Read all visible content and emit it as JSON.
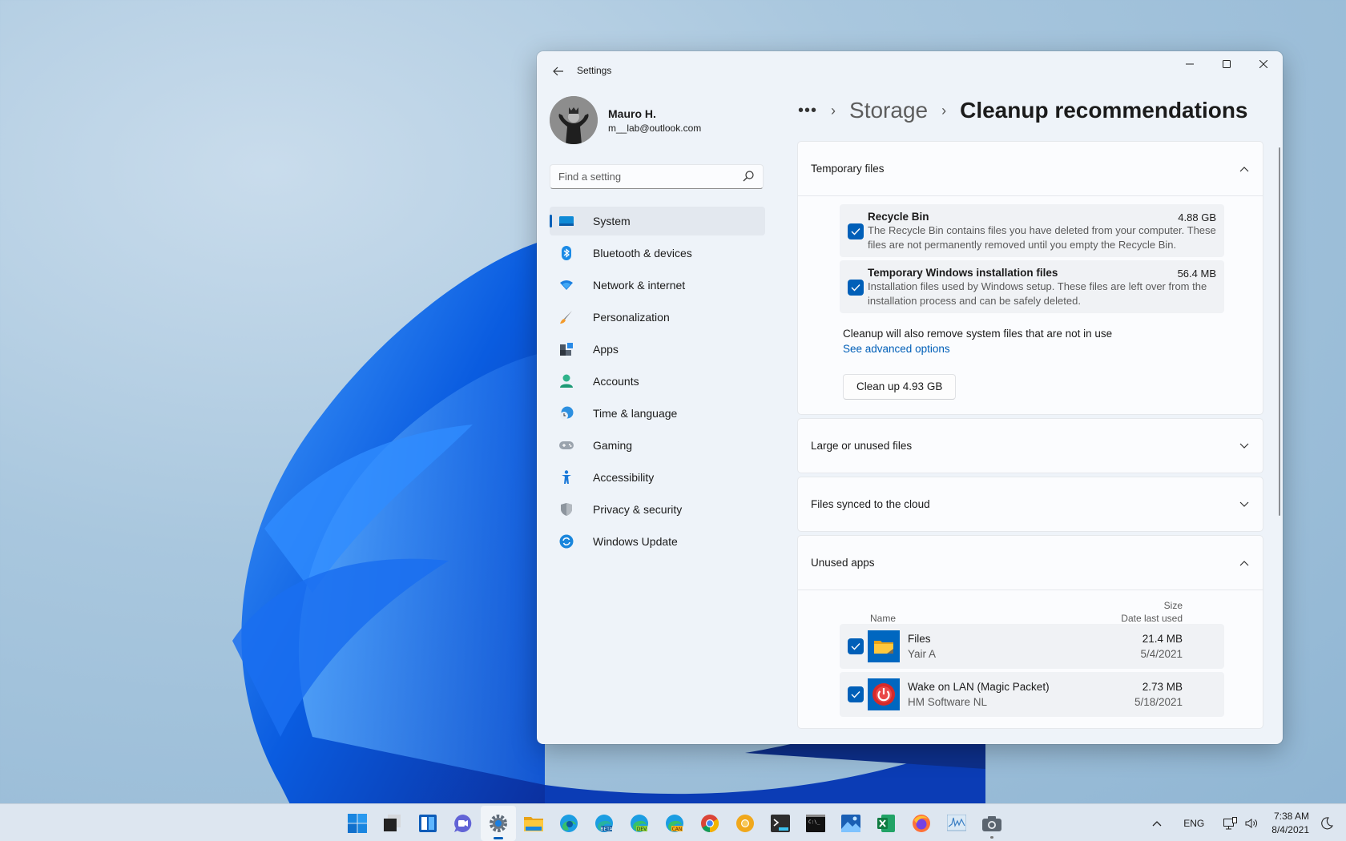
{
  "window": {
    "title": "Settings",
    "controls": {
      "minimize": "minimize",
      "maximize": "maximize",
      "close": "close"
    }
  },
  "profile": {
    "name": "Mauro H.",
    "email": "m__lab@outlook.com"
  },
  "search": {
    "placeholder": "Find a setting",
    "value": ""
  },
  "sidebar": {
    "items": [
      {
        "label": "System",
        "icon": "system-icon",
        "active": true
      },
      {
        "label": "Bluetooth & devices",
        "icon": "bluetooth-icon"
      },
      {
        "label": "Network & internet",
        "icon": "wifi-icon"
      },
      {
        "label": "Personalization",
        "icon": "brush-icon"
      },
      {
        "label": "Apps",
        "icon": "apps-icon"
      },
      {
        "label": "Accounts",
        "icon": "person-icon"
      },
      {
        "label": "Time & language",
        "icon": "globe-clock-icon"
      },
      {
        "label": "Gaming",
        "icon": "gamepad-icon"
      },
      {
        "label": "Accessibility",
        "icon": "accessibility-icon"
      },
      {
        "label": "Privacy & security",
        "icon": "shield-icon"
      },
      {
        "label": "Windows Update",
        "icon": "update-icon"
      }
    ]
  },
  "breadcrumb": {
    "more": "•••",
    "separator": "›",
    "parent": "Storage",
    "current": "Cleanup recommendations"
  },
  "sections": {
    "temporary_files": {
      "title": "Temporary files",
      "expanded": true,
      "items": [
        {
          "title": "Recycle Bin",
          "size": "4.88 GB",
          "checked": true,
          "description": "The Recycle Bin contains files you have deleted from your computer. These files are not permanently removed until you empty the Recycle Bin."
        },
        {
          "title": "Temporary Windows installation files",
          "size": "56.4 MB",
          "checked": true,
          "description": "Installation files used by Windows setup.  These files are left over from the installation process and can be safely deleted."
        }
      ],
      "note": "Cleanup will also remove system files that are not in use",
      "advanced_link": "See advanced options",
      "cleanup_button": "Clean up 4.93 GB"
    },
    "large_files": {
      "title": "Large or unused files",
      "expanded": false
    },
    "cloud_files": {
      "title": "Files synced to the cloud",
      "expanded": false
    },
    "unused_apps": {
      "title": "Unused apps",
      "expanded": true,
      "columns": {
        "name": "Name",
        "size": "Size",
        "date": "Date last used"
      },
      "apps": [
        {
          "name": "Files",
          "publisher": "Yair A",
          "size": "21.4 MB",
          "date": "5/4/2021",
          "checked": true,
          "icon": "folder-icon"
        },
        {
          "name": "Wake on LAN (Magic Packet)",
          "publisher": "HM Software NL",
          "size": "2.73 MB",
          "date": "5/18/2021",
          "checked": true,
          "icon": "power-icon"
        }
      ]
    }
  },
  "taskbar": {
    "apps": [
      {
        "name": "start",
        "icon": "windows-logo-icon"
      },
      {
        "name": "task-view",
        "icon": "task-view-icon"
      },
      {
        "name": "widgets",
        "icon": "widgets-icon"
      },
      {
        "name": "chat",
        "icon": "chat-icon"
      },
      {
        "name": "settings",
        "icon": "gear-icon",
        "active": true
      },
      {
        "name": "file-explorer",
        "icon": "folder-icon"
      },
      {
        "name": "edge",
        "icon": "edge-icon"
      },
      {
        "name": "edge-beta",
        "icon": "edge-beta-icon",
        "badge": "BETA"
      },
      {
        "name": "edge-dev",
        "icon": "edge-dev-icon",
        "badge": "DEV"
      },
      {
        "name": "edge-canary",
        "icon": "edge-canary-icon",
        "badge": "CAN"
      },
      {
        "name": "chrome",
        "icon": "chrome-icon"
      },
      {
        "name": "chrome-canary",
        "icon": "chrome-canary-icon"
      },
      {
        "name": "terminal",
        "icon": "terminal-icon"
      },
      {
        "name": "command-prompt",
        "icon": "cmd-icon"
      },
      {
        "name": "photos",
        "icon": "photos-icon"
      },
      {
        "name": "excel",
        "icon": "excel-icon"
      },
      {
        "name": "firefox",
        "icon": "firefox-icon"
      },
      {
        "name": "resource-monitor",
        "icon": "monitor-chart-icon"
      },
      {
        "name": "camera",
        "icon": "camera-icon",
        "running": true
      }
    ],
    "tray": {
      "language": "ENG",
      "time": "7:38 AM",
      "date": "8/4/2021"
    }
  },
  "colors": {
    "accent": "#005fb8",
    "window_bg": "#eef3f9",
    "card_bg": "#fbfcfe",
    "link": "#005fb8"
  }
}
